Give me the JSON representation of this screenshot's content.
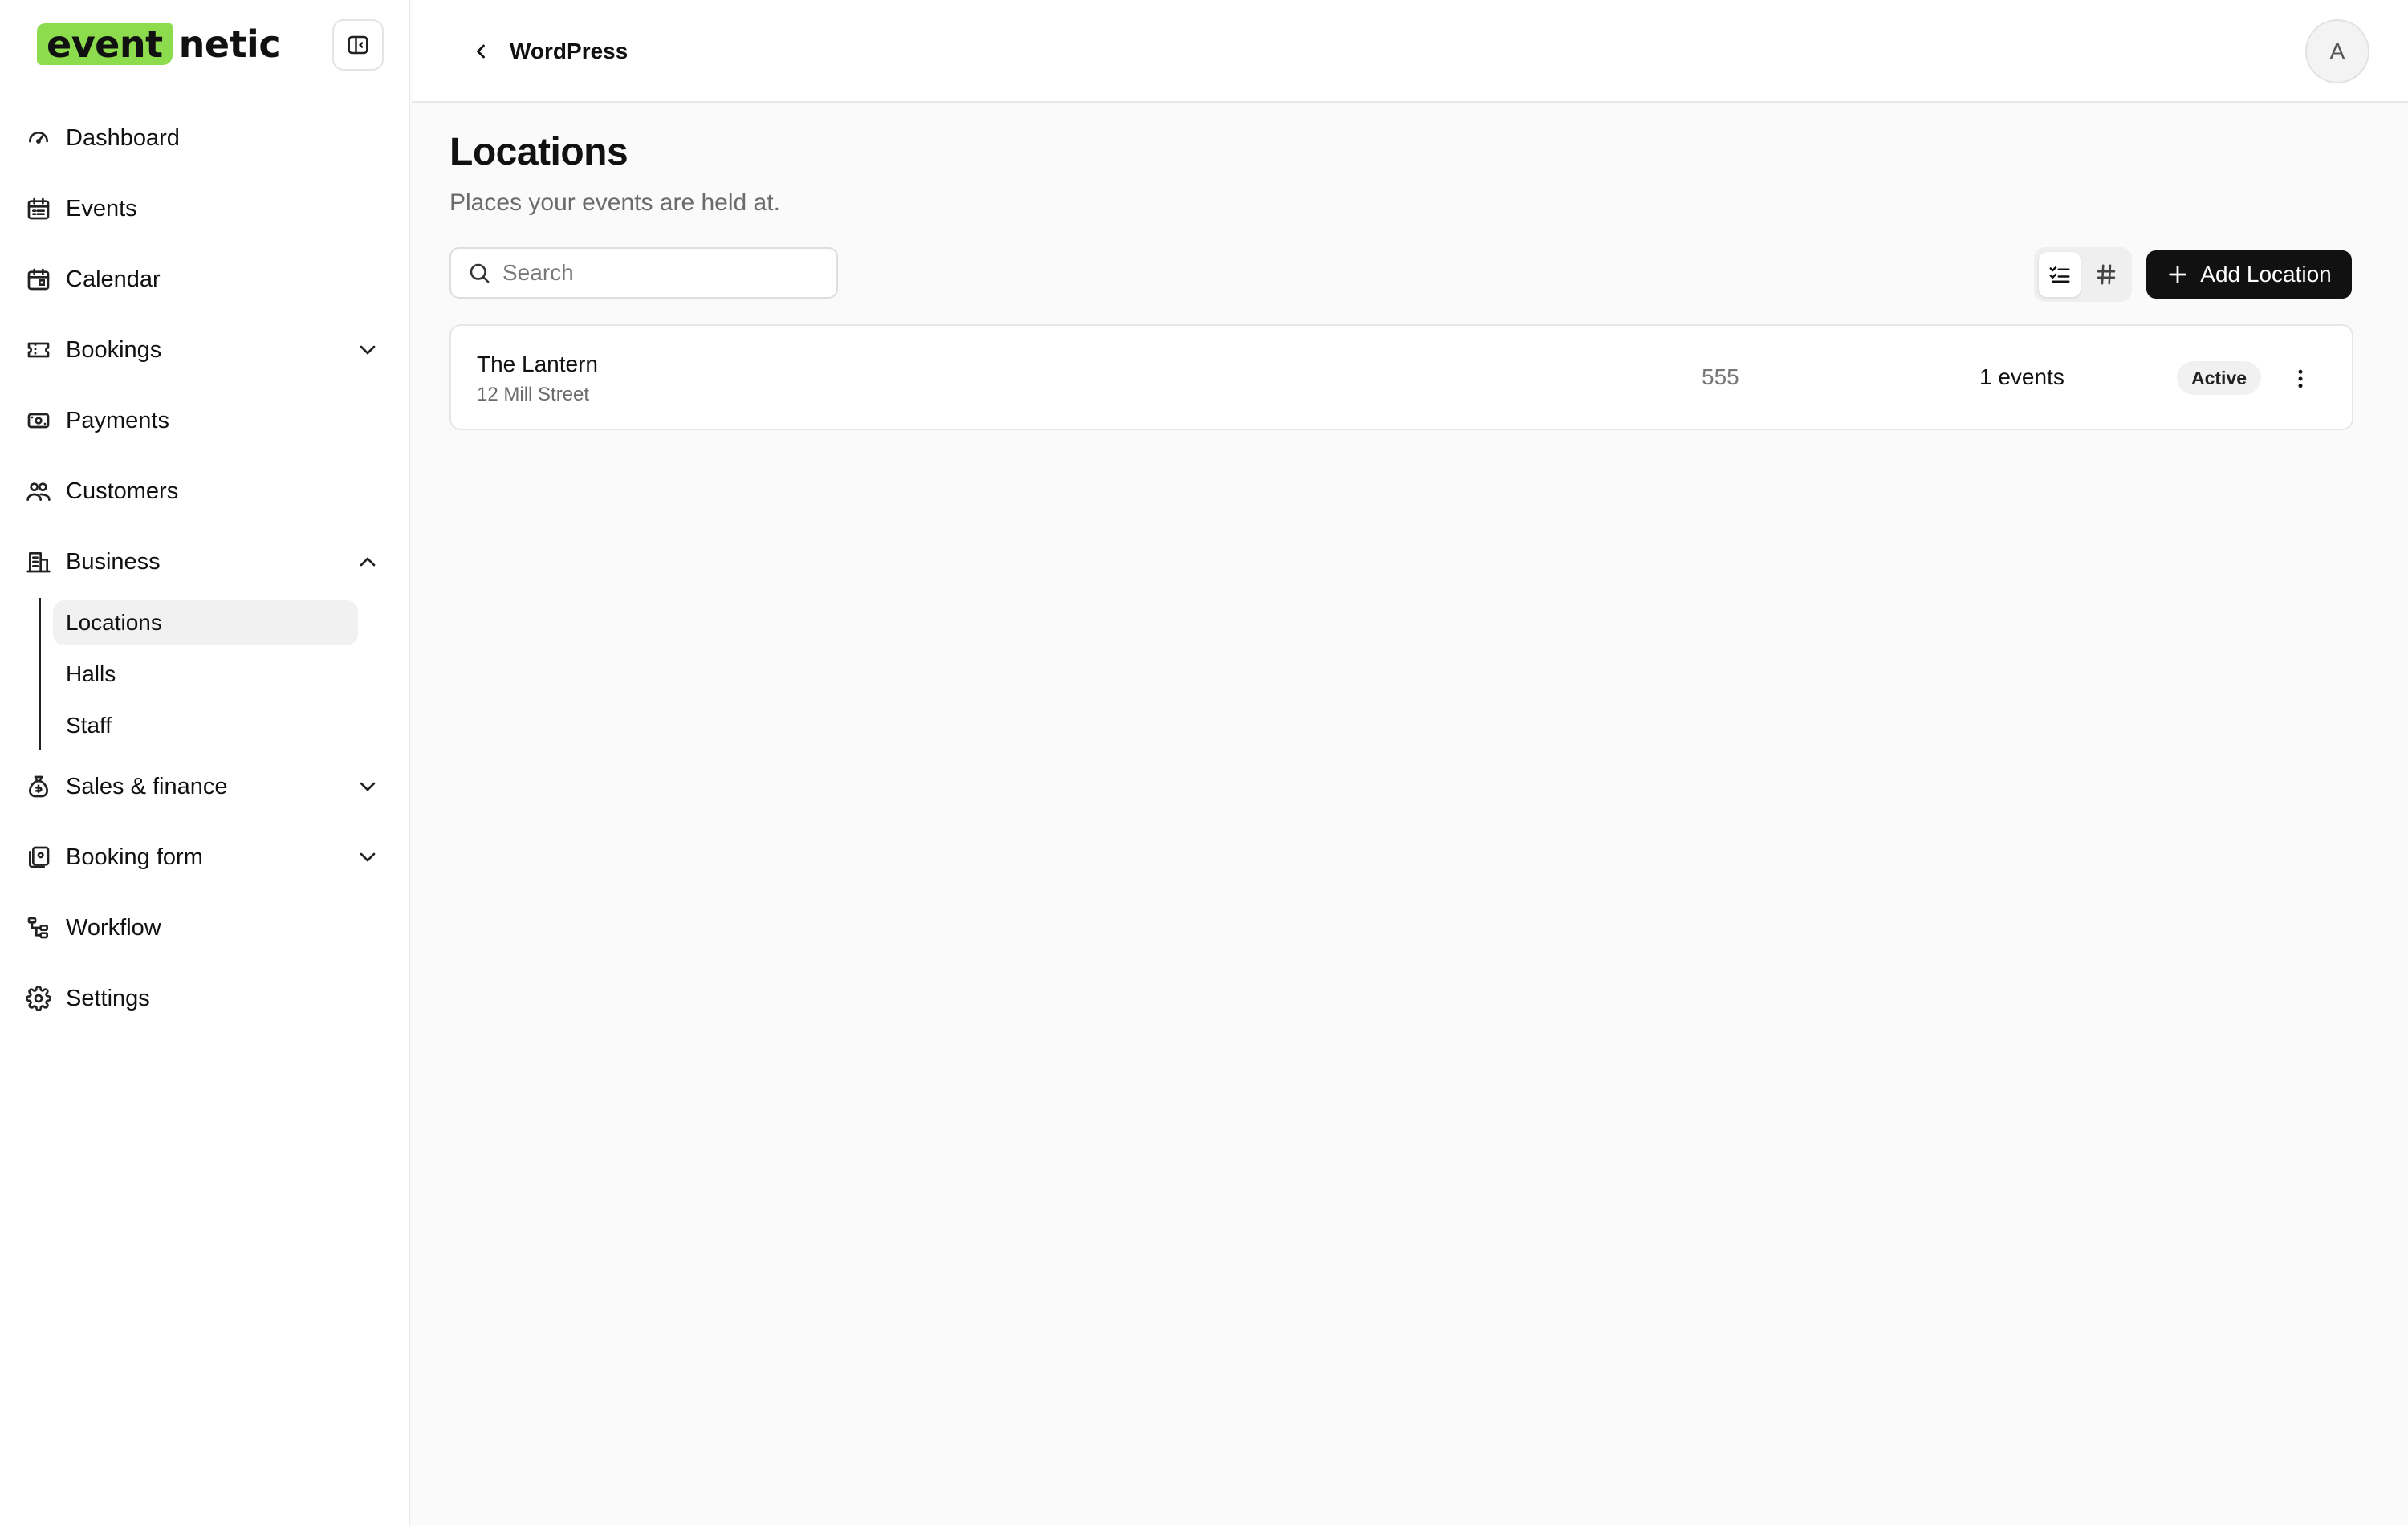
{
  "brand": {
    "highlight": "event",
    "rest": "netic",
    "accent": "#8ddc4d"
  },
  "sidebar": {
    "items": [
      {
        "label": "Dashboard"
      },
      {
        "label": "Events"
      },
      {
        "label": "Calendar"
      },
      {
        "label": "Bookings"
      },
      {
        "label": "Payments"
      },
      {
        "label": "Customers"
      },
      {
        "label": "Business"
      },
      {
        "label": "Sales & finance"
      },
      {
        "label": "Booking form"
      },
      {
        "label": "Workflow"
      },
      {
        "label": "Settings"
      }
    ],
    "business_sub": [
      {
        "label": "Locations",
        "active": true
      },
      {
        "label": "Halls"
      },
      {
        "label": "Staff"
      }
    ]
  },
  "header": {
    "back_label": "WordPress",
    "avatar_initial": "A"
  },
  "main": {
    "title": "Locations",
    "subtitle": "Places your events are held at.",
    "search_placeholder": "Search",
    "add_button": "Add Location",
    "view_mode": "list"
  },
  "locations": [
    {
      "name": "The Lantern",
      "address": "12 Mill Street",
      "number": "555",
      "events": "1 events",
      "status": "Active"
    }
  ],
  "colors": {
    "primary_button": "#111111",
    "background": "#fafafa"
  }
}
